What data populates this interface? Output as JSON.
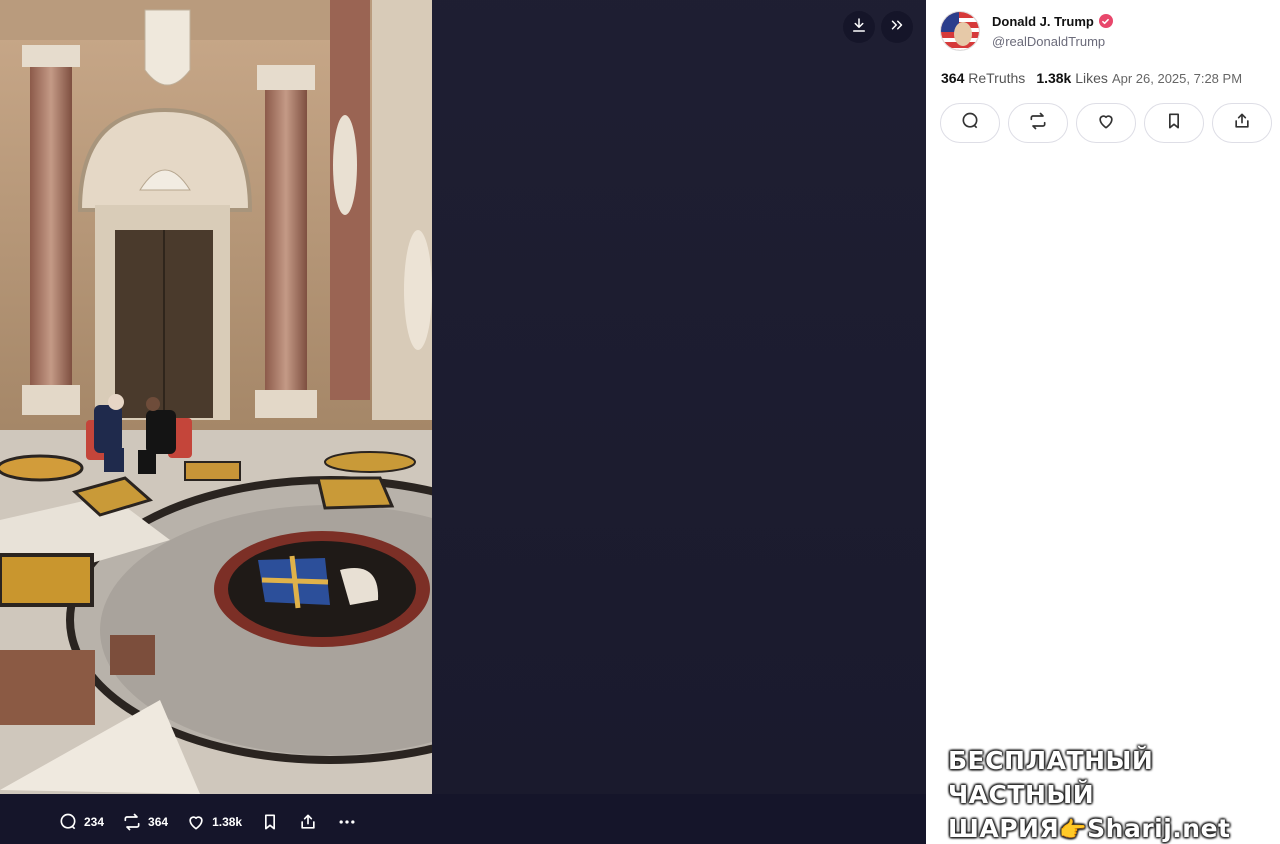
{
  "media": {
    "comments_count": "234",
    "retruths_count": "364",
    "likes_count": "1.38k"
  },
  "post": {
    "author_name": "Donald J. Trump",
    "author_handle": "@realDonaldTrump",
    "retruths_count": "364",
    "retruths_label": "ReTruths",
    "likes_count": "1.38k",
    "likes_label": "Likes",
    "timestamp": "Apr 26, 2025, 7:28 PM"
  },
  "watermark": {
    "line1": "БЕСПЛАТНЫЙ ЧАСТНЫЙ",
    "line2_prefix": "ШАРИЯ",
    "line2_hand": "👉",
    "line2_suffix": "Sharij.net"
  },
  "icons": {
    "media_bar": [
      "comment-icon",
      "retruth-icon",
      "heart-icon",
      "bookmark-icon",
      "share-icon",
      "more-icon"
    ],
    "top": [
      "download-icon",
      "expand-icon"
    ],
    "post_actions": [
      "comment-icon",
      "retruth-icon",
      "heart-icon",
      "bookmark-icon",
      "share-icon"
    ]
  },
  "colors": {
    "viewer_bg": "#1b1b2f",
    "verified_badge": "#e8476b"
  }
}
